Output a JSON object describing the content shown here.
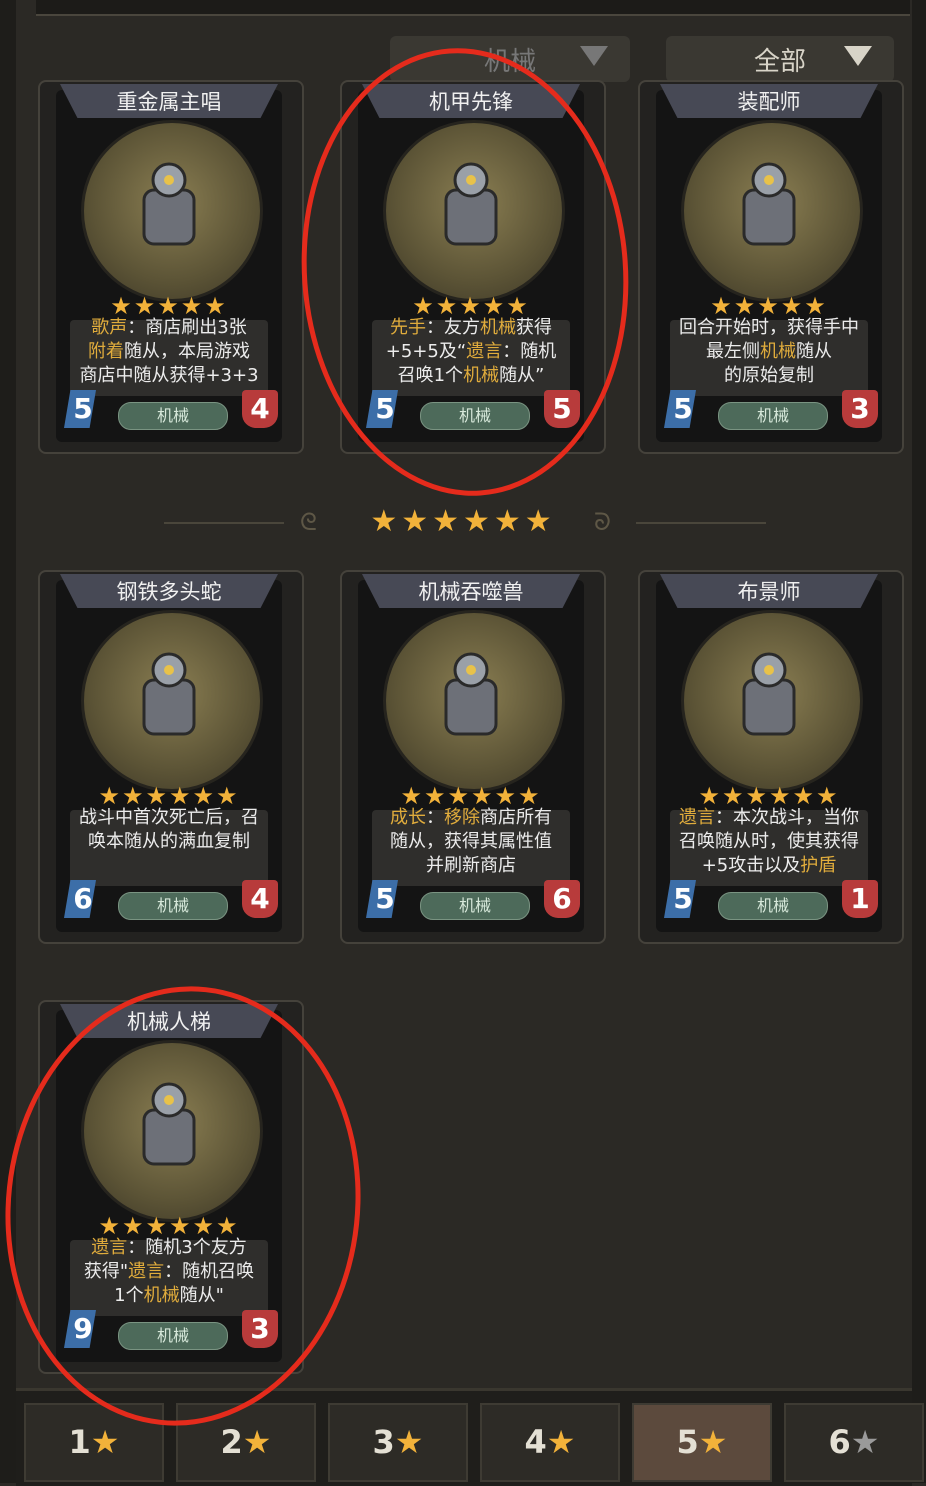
{
  "filters": {
    "tribe": "机械",
    "scope": "全部"
  },
  "divider": {
    "stars": "★★★★★★"
  },
  "cards": [
    {
      "name": "重金属主唱",
      "stars": "★★★★★",
      "attack": "5",
      "health": "4",
      "tribe": "机械",
      "desc": [
        [
          {
            "t": "歌声",
            "h": true
          },
          {
            "t": "：商店刷出3张",
            "h": false
          }
        ],
        [
          {
            "t": "附着",
            "h": true
          },
          {
            "t": "随从，本局游戏",
            "h": false
          }
        ],
        [
          {
            "t": "商店中随从获得+3+3",
            "h": false
          }
        ]
      ]
    },
    {
      "name": "机甲先锋",
      "stars": "★★★★★",
      "attack": "5",
      "health": "5",
      "tribe": "机械",
      "desc": [
        [
          {
            "t": "先手",
            "h": true
          },
          {
            "t": "：友方",
            "h": false
          },
          {
            "t": "机械",
            "h": true
          },
          {
            "t": "获得",
            "h": false
          }
        ],
        [
          {
            "t": "+5+5及“",
            "h": false
          },
          {
            "t": "遗言",
            "h": true
          },
          {
            "t": "：随机",
            "h": false
          }
        ],
        [
          {
            "t": "召唤1个",
            "h": false
          },
          {
            "t": "机械",
            "h": true
          },
          {
            "t": "随从”",
            "h": false
          }
        ]
      ]
    },
    {
      "name": "装配师",
      "stars": "★★★★★",
      "attack": "5",
      "health": "3",
      "tribe": "机械",
      "desc": [
        [
          {
            "t": "回合开始时，获得手中",
            "h": false
          }
        ],
        [
          {
            "t": "最左侧",
            "h": false
          },
          {
            "t": "机械",
            "h": true
          },
          {
            "t": "随从",
            "h": false
          }
        ],
        [
          {
            "t": "的原始复制",
            "h": false
          }
        ]
      ]
    },
    {
      "name": "钢铁多头蛇",
      "stars": "★★★★★★",
      "attack": "6",
      "health": "4",
      "tribe": "机械",
      "desc": [
        [
          {
            "t": "战斗中首次死亡后，召",
            "h": false
          }
        ],
        [
          {
            "t": "唤本随从的满血复制",
            "h": false
          }
        ]
      ]
    },
    {
      "name": "机械吞噬兽",
      "stars": "★★★★★★",
      "attack": "5",
      "health": "6",
      "tribe": "机械",
      "desc": [
        [
          {
            "t": "成长",
            "h": true
          },
          {
            "t": "：",
            "h": false
          },
          {
            "t": "移除",
            "h": true
          },
          {
            "t": "商店所有",
            "h": false
          }
        ],
        [
          {
            "t": "随从，获得其属性值",
            "h": false
          }
        ],
        [
          {
            "t": "并刷新商店",
            "h": false
          }
        ]
      ]
    },
    {
      "name": "布景师",
      "stars": "★★★★★★",
      "attack": "5",
      "health": "1",
      "tribe": "机械",
      "desc": [
        [
          {
            "t": "遗言",
            "h": true
          },
          {
            "t": "：本次战斗，当你",
            "h": false
          }
        ],
        [
          {
            "t": "召唤随从时，使其获得",
            "h": false
          }
        ],
        [
          {
            "t": "+5攻击以及",
            "h": false
          },
          {
            "t": "护盾",
            "h": true
          }
        ]
      ]
    },
    {
      "name": "机械人梯",
      "stars": "★★★★★★",
      "attack": "9",
      "health": "3",
      "tribe": "机械",
      "desc": [
        [
          {
            "t": "遗言",
            "h": true
          },
          {
            "t": "：随机3个友方",
            "h": false
          }
        ],
        [
          {
            "t": "获得\"",
            "h": false
          },
          {
            "t": "遗言",
            "h": true
          },
          {
            "t": "：随机召唤",
            "h": false
          }
        ],
        [
          {
            "t": "1个",
            "h": false
          },
          {
            "t": "机械",
            "h": true
          },
          {
            "t": "随从\"",
            "h": false
          }
        ]
      ]
    }
  ],
  "tabs": [
    {
      "num": "1",
      "star": "★"
    },
    {
      "num": "2",
      "star": "★"
    },
    {
      "num": "3",
      "star": "★"
    },
    {
      "num": "4",
      "star": "★"
    },
    {
      "num": "5",
      "star": "★"
    },
    {
      "num": "6",
      "star": "★"
    }
  ],
  "selected_tab": "5",
  "colors": {
    "highlight": "#e0ac3c",
    "star": "#f2b23a",
    "annotation": "#e52b1c",
    "attack": "#3c6ea8",
    "health": "#b83b3b"
  }
}
